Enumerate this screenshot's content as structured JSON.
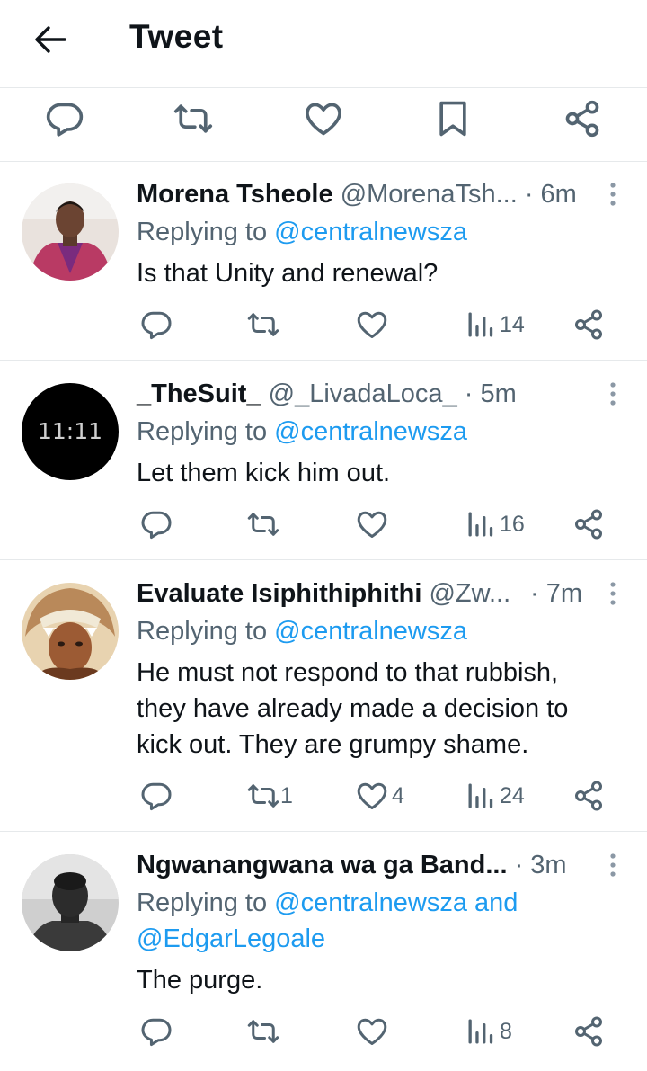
{
  "header": {
    "title": "Tweet"
  },
  "tweets": [
    {
      "name": "Morena Tsheole",
      "handle": "@MorenaTsh...",
      "time": "· 6m",
      "replying_prefix": "Replying to ",
      "mention": "@centralnewsza",
      "text": "Is that Unity and renewal?",
      "views": "14"
    },
    {
      "name": "_TheSuit_",
      "handle": "@_LivadaLoca_",
      "time": "· 5m",
      "replying_prefix": "Replying to ",
      "mention": "@centralnewsza",
      "text": "Let them kick him out.",
      "views": "16",
      "avatar_text": "11:11"
    },
    {
      "name": "Evaluate Isiphithiphithi",
      "handle": "@Zw...",
      "time": "· 7m",
      "replying_prefix": "Replying to ",
      "mention": "@centralnewsza",
      "text_lines": [
        "He must not respond to that rubbish,",
        "they have already made a decision to",
        "kick out. They are grumpy shame."
      ],
      "retweets": "1",
      "likes": "4",
      "views": "24"
    },
    {
      "name": "Ngwanangwana wa ga Band...",
      "time": "· 3m",
      "replying_prefix": "Replying to ",
      "mention": "@centralnewsza",
      "mention_joiner": " and",
      "mention2": "@EdgarLegoale",
      "text": "The purge.",
      "views": "8"
    }
  ],
  "colors": {
    "accent": "#1d9bf0",
    "text": "#0f1419",
    "muted": "#536471",
    "divider": "#e6e9eb",
    "icon": "#536471"
  },
  "icons": [
    "back-arrow-icon",
    "reply-icon",
    "retweet-icon",
    "like-icon",
    "bookmark-icon",
    "share-icon",
    "views-icon",
    "more-icon"
  ]
}
